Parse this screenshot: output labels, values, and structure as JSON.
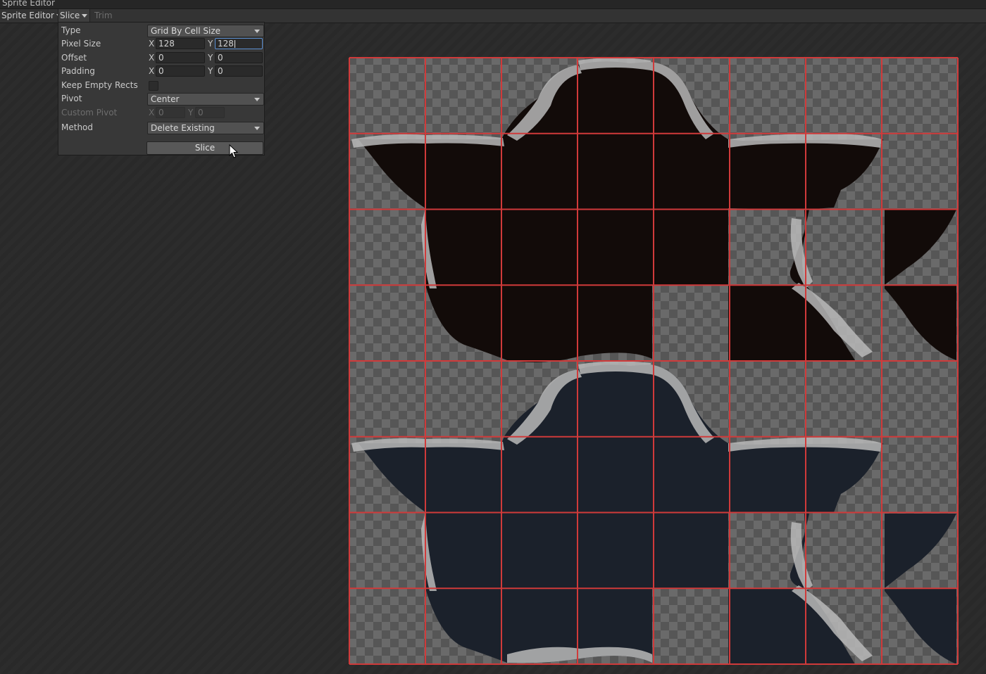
{
  "window": {
    "tab_title": "Sprite Editor"
  },
  "toolbar": {
    "mode_label": "Sprite Editor",
    "slice_label": "Slice",
    "trim_label": "Trim"
  },
  "slice_panel": {
    "type_label": "Type",
    "type_value": "Grid By Cell Size",
    "pixel_size_label": "Pixel Size",
    "pixel_size_x": "128",
    "pixel_size_y": "128",
    "offset_label": "Offset",
    "offset_x": "0",
    "offset_y": "0",
    "padding_label": "Padding",
    "padding_x": "0",
    "padding_y": "0",
    "keep_empty_label": "Keep Empty Rects",
    "keep_empty_checked": false,
    "pivot_label": "Pivot",
    "pivot_value": "Center",
    "custom_pivot_label": "Custom Pivot",
    "custom_pivot_x": "0",
    "custom_pivot_y": "0",
    "method_label": "Method",
    "method_value": "Delete Existing",
    "slice_button": "Slice",
    "axis_x": "X",
    "axis_y": "Y"
  },
  "texture": {
    "grid_columns": 8,
    "grid_rows": 8,
    "grid_line_color": "#d03a3a",
    "checker_light": "#6a6a6a",
    "checker_dark": "#565656",
    "top_fill_color": "#120b09",
    "bottom_fill_color": "#1b212b",
    "rock_color": "#b9b9b9"
  }
}
